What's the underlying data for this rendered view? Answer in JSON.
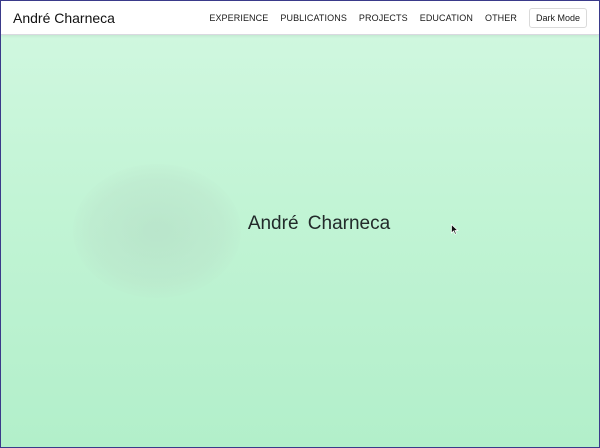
{
  "navbar": {
    "brand": "André Charneca",
    "links": [
      {
        "label": "EXPERIENCE"
      },
      {
        "label": "PUBLICATIONS"
      },
      {
        "label": "PROJECTS"
      },
      {
        "label": "EDUCATION"
      },
      {
        "label": "OTHER"
      }
    ],
    "mode_button": "Dark Mode"
  },
  "hero": {
    "title": "André Charneca"
  },
  "colors": {
    "background_top": "#d2f8e1",
    "background_bottom": "#b2efca",
    "navbar_bg": "#ffffff",
    "text": "#222a2a"
  },
  "icons": {
    "cursor": "mouse-pointer-icon"
  }
}
